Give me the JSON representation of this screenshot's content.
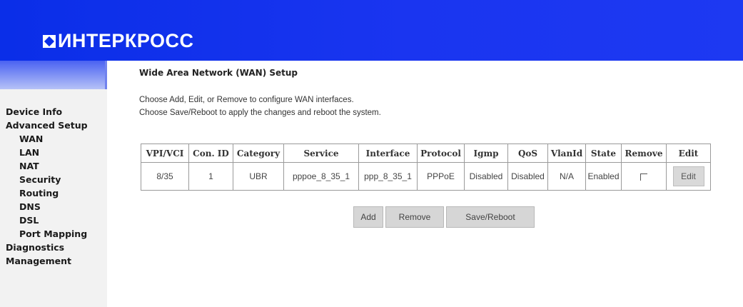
{
  "header": {
    "logo_text": "ИНТЕРКРОСС"
  },
  "sidebar": {
    "items": [
      {
        "label": "Device Info",
        "sub": false
      },
      {
        "label": "Advanced Setup",
        "sub": false
      },
      {
        "label": "WAN",
        "sub": true
      },
      {
        "label": "LAN",
        "sub": true
      },
      {
        "label": "NAT",
        "sub": true
      },
      {
        "label": "Security",
        "sub": true
      },
      {
        "label": "Routing",
        "sub": true
      },
      {
        "label": "DNS",
        "sub": true
      },
      {
        "label": "DSL",
        "sub": true
      },
      {
        "label": "Port Mapping",
        "sub": true
      },
      {
        "label": "Diagnostics",
        "sub": false
      },
      {
        "label": "Management",
        "sub": false
      }
    ]
  },
  "main": {
    "title": "Wide Area Network (WAN) Setup",
    "desc_line1": "Choose Add, Edit, or Remove to configure WAN interfaces.",
    "desc_line2": "Choose Save/Reboot to apply the changes and reboot the system.",
    "table": {
      "headers": [
        "VPI/VCI",
        "Con. ID",
        "Category",
        "Service",
        "Interface",
        "Protocol",
        "Igmp",
        "QoS",
        "VlanId",
        "State",
        "Remove",
        "Edit"
      ],
      "rows": [
        {
          "vpivci": "8/35",
          "conid": "1",
          "category": "UBR",
          "service": "pppoe_8_35_1",
          "interface": "ppp_8_35_1",
          "protocol": "PPPoE",
          "igmp": "Disabled",
          "qos": "Disabled",
          "vlanid": "N/A",
          "state": "Enabled",
          "remove_checked": false,
          "edit_label": "Edit"
        }
      ]
    },
    "buttons": {
      "add": "Add",
      "remove": "Remove",
      "save_reboot": "Save/Reboot"
    }
  }
}
